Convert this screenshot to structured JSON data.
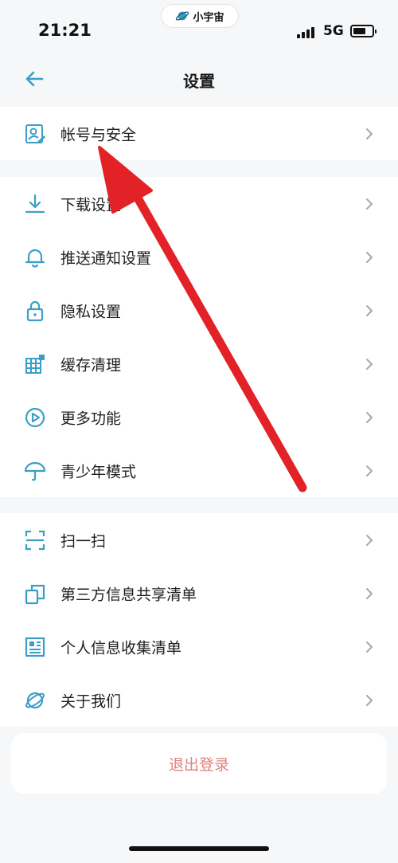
{
  "status_bar": {
    "time": "21:21",
    "app_name": "小宇宙",
    "network": "5G"
  },
  "nav": {
    "title": "设置"
  },
  "sections": [
    {
      "items": [
        {
          "label": "帐号与安全",
          "icon": "account-security-icon"
        }
      ]
    },
    {
      "items": [
        {
          "label": "下载设置",
          "icon": "download-icon"
        },
        {
          "label": "推送通知设置",
          "icon": "bell-icon"
        },
        {
          "label": "隐私设置",
          "icon": "lock-icon"
        },
        {
          "label": "缓存清理",
          "icon": "grid-icon"
        },
        {
          "label": "更多功能",
          "icon": "play-circle-icon"
        },
        {
          "label": "青少年模式",
          "icon": "umbrella-icon"
        }
      ]
    },
    {
      "items": [
        {
          "label": "扫一扫",
          "icon": "scan-icon"
        },
        {
          "label": "第三方信息共享清单",
          "icon": "copy-icon"
        },
        {
          "label": "个人信息收集清单",
          "icon": "document-icon"
        },
        {
          "label": "关于我们",
          "icon": "planet-icon"
        }
      ]
    }
  ],
  "logout": {
    "label": "退出登录"
  },
  "colors": {
    "accent": "#3a9ec7",
    "logout_text": "#e0807c",
    "annotation_arrow": "#e32227"
  }
}
